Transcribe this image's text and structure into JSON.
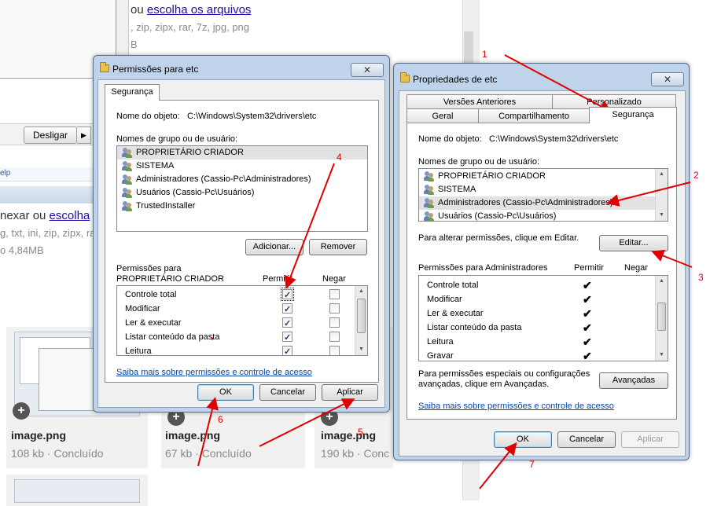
{
  "background": {
    "top_link_prefix": "ou ",
    "top_link": "escolha os arquivos",
    "top_ext": ", zip, zipx, rar, 7z, jpg, png",
    "top_size": "B",
    "mid_link_prefix": "nexar ou ",
    "mid_link": "escolha",
    "mid_ext": "g, txt, ini, zip, zipx, ra",
    "mid_size": "o 4,84MB",
    "strip_text": "elp",
    "desligar_label": "Desligar",
    "cards": [
      {
        "name": "image.png",
        "meta": "108 kb · Concluído"
      },
      {
        "name": "image.png",
        "meta": "67 kb · Concluído"
      },
      {
        "name": "image.png",
        "meta": "190 kb · Conc"
      }
    ]
  },
  "perm_dialog": {
    "title": "Permissões para etc",
    "close_label": "✕",
    "tab": "Segurança",
    "object_label": "Nome do objeto:",
    "object_path": "C:\\Windows\\System32\\drivers\\etc",
    "group_label": "Nomes de grupo ou de usuário:",
    "groups": [
      "PROPRIETÁRIO CRIADOR",
      "SISTEMA",
      "Administradores (Cassio-Pc\\Administradores)",
      "Usuários (Cassio-Pc\\Usuários)",
      "TrustedInstaller"
    ],
    "add_button": "Adicionar...",
    "remove_button": "Remover",
    "perm_for_label": "Permissões para",
    "perm_for_name": "PROPRIETÁRIO CRIADOR",
    "col_allow": "Permitir",
    "col_deny": "Negar",
    "permissions": [
      {
        "name": "Controle total",
        "allow": true,
        "deny": false
      },
      {
        "name": "Modificar",
        "allow": true,
        "deny": false
      },
      {
        "name": "Ler & executar",
        "allow": true,
        "deny": false
      },
      {
        "name": "Listar conteúdo da pasta",
        "allow": true,
        "deny": false
      },
      {
        "name": "Leitura",
        "allow": true,
        "deny": false
      }
    ],
    "help_link": "Saiba mais sobre permissões e controle de acesso",
    "ok_button": "OK",
    "cancel_button": "Cancelar",
    "apply_button": "Aplicar"
  },
  "props_dialog": {
    "title": "Propriedades de etc",
    "close_label": "✕",
    "tabs_row1": [
      "Versões Anteriores",
      "Personalizado"
    ],
    "tabs_row2": [
      "Geral",
      "Compartilhamento",
      "Segurança"
    ],
    "object_label": "Nome do objeto:",
    "object_path": "C:\\Windows\\System32\\drivers\\etc",
    "group_label": "Nomes de grupo ou de usuário:",
    "groups": [
      "PROPRIETÁRIO CRIADOR",
      "SISTEMA",
      "Administradores (Cassio-Pc\\Administradores)",
      "Usuários (Cassio-Pc\\Usuários)"
    ],
    "edit_hint": "Para alterar permissões, clique em Editar.",
    "edit_button": "Editar...",
    "perm_for_label": "Permissões para Administradores",
    "col_allow": "Permitir",
    "col_deny": "Negar",
    "permissions": [
      {
        "name": "Controle total",
        "allow": true
      },
      {
        "name": "Modificar",
        "allow": true
      },
      {
        "name": "Ler & executar",
        "allow": true
      },
      {
        "name": "Listar conteúdo da pasta",
        "allow": true
      },
      {
        "name": "Leitura",
        "allow": true
      },
      {
        "name": "Gravar",
        "allow": true
      }
    ],
    "special_text_1": "Para permissões especiais ou configurações",
    "special_text_2": "avançadas, clique em Avançadas.",
    "advanced_button": "Avançadas",
    "help_link": "Saiba mais sobre permissões e controle de acesso",
    "ok_button": "OK",
    "cancel_button": "Cancelar",
    "apply_button": "Aplicar"
  },
  "annotations": [
    "1",
    "2",
    "3",
    "4",
    "5",
    "6",
    "7"
  ],
  "annotation_color": "#e00000"
}
